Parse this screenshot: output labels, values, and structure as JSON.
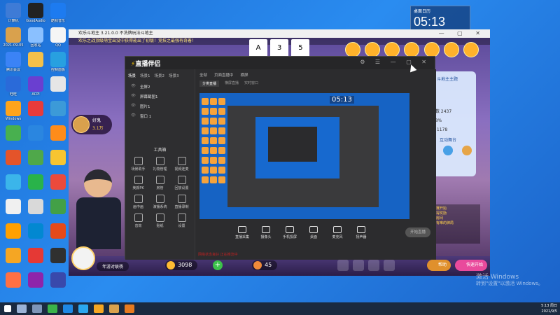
{
  "desktop": {
    "icons": [
      {
        "label": "计算机",
        "color": "#3e7bd6"
      },
      {
        "label": "GoodAudio",
        "color": "#222222"
      },
      {
        "label": "酷我音乐",
        "color": "#1d7bf0"
      },
      {
        "label": "2021-09-05",
        "color": "#d9a14d"
      },
      {
        "label": "回收站",
        "color": "#8ac0ff"
      },
      {
        "label": "QQ",
        "color": "#f5f5f5"
      },
      {
        "label": "腾讯会议",
        "color": "#3b83f6"
      },
      {
        "label": "",
        "color": "#f4c04a"
      },
      {
        "label": "控制面板",
        "color": "#28a0e0"
      },
      {
        "label": "旺旺",
        "color": "#2a6ad9"
      },
      {
        "label": "ACPI",
        "color": "#6a3fd0"
      },
      {
        "label": "",
        "color": "#e6e6e6"
      },
      {
        "label": "Windows",
        "color": "#ffa41b"
      },
      {
        "label": "",
        "color": "#e83b3b"
      },
      {
        "label": "",
        "color": "#3c9ad8"
      },
      {
        "label": "",
        "color": "#48b04f"
      },
      {
        "label": "",
        "color": "#2a86e0"
      },
      {
        "label": "",
        "color": "#ff8c1a"
      },
      {
        "label": "",
        "color": "#e4542a"
      },
      {
        "label": "",
        "color": "#4fa84a"
      },
      {
        "label": "",
        "color": "#f7c531"
      },
      {
        "label": "",
        "color": "#3bb5ea"
      },
      {
        "label": "",
        "color": "#29b34a"
      },
      {
        "label": "",
        "color": "#eb4a3c"
      },
      {
        "label": "",
        "color": "#f0f0f0"
      },
      {
        "label": "",
        "color": "#d9d9d9"
      },
      {
        "label": "",
        "color": "#43a047"
      },
      {
        "label": "",
        "color": "#ffa000"
      },
      {
        "label": "",
        "color": "#0288d1"
      },
      {
        "label": "",
        "color": "#e64a19"
      },
      {
        "label": "",
        "color": "#f5a623"
      },
      {
        "label": "",
        "color": "#e53935"
      },
      {
        "label": "",
        "color": "#303030"
      },
      {
        "label": "",
        "color": "#ff7043"
      },
      {
        "label": "",
        "color": "#8e24aa"
      },
      {
        "label": "",
        "color": "#3949ab"
      }
    ]
  },
  "clock_widget": {
    "caption": "桌面日历",
    "time": "05:13"
  },
  "game": {
    "title": "欢乐斗地主 3.21.0.0  不洗牌玩法斗地主",
    "notice": "欢乐之战顶级萌宝出没中获得能出了初版！竞技之最强有奇着！",
    "player_name": "好鬼",
    "player_score": "3.1万",
    "cards": [
      "A",
      "3",
      "5"
    ],
    "my_name": "年游对联杨",
    "coins": "3098",
    "beans": "45",
    "rp_title": "斗地主主题",
    "rp_rank_label": "名次",
    "rp_stats": [
      "游戏局数 2437",
      "胜率 48%",
      "胜局数 1178"
    ],
    "rp_section": "互动舞台",
    "chat_lines": [
      "斗地主比赛开始",
      "恭喜你获得奖励",
      "欢迎进入房间",
      "让天下没有难的牌局"
    ],
    "btn_help": "帮助",
    "btn_quick": "快速开始"
  },
  "stream": {
    "logo": "直播伴侣",
    "side_tabs": [
      "场景",
      "场景1",
      "场景2",
      "场景3"
    ],
    "scenes": [
      "全屏2",
      "屏幕截图1",
      "图片1",
      "窗口 1"
    ],
    "tool_title": "工具箱",
    "tools": [
      "场景助手",
      "礼物管理",
      "视频连麦",
      "美颜PK",
      "房管",
      "回放设置",
      "画中画",
      "演播系统",
      "直播录制",
      "音效",
      "贴纸",
      "设置"
    ],
    "main_tabs": [
      "全部",
      "页面直播中",
      "横屏"
    ],
    "main_tabs2": [
      "分类直播",
      "横屏直播",
      "实时窗口"
    ],
    "preview_clock": "05:13",
    "controls": [
      "直播采集",
      "摄像头",
      "手机投屏",
      "桌面",
      "麦克风",
      "扬声器"
    ],
    "start_label": "开始直播",
    "status": "网络状态良好 正在推流中"
  },
  "windows": {
    "activate_line1": "激活 Windows",
    "activate_line2": "转到\"设置\"以激活 Windows。",
    "tray_time": "5:13 周日",
    "tray_date": "2021/9/5"
  }
}
